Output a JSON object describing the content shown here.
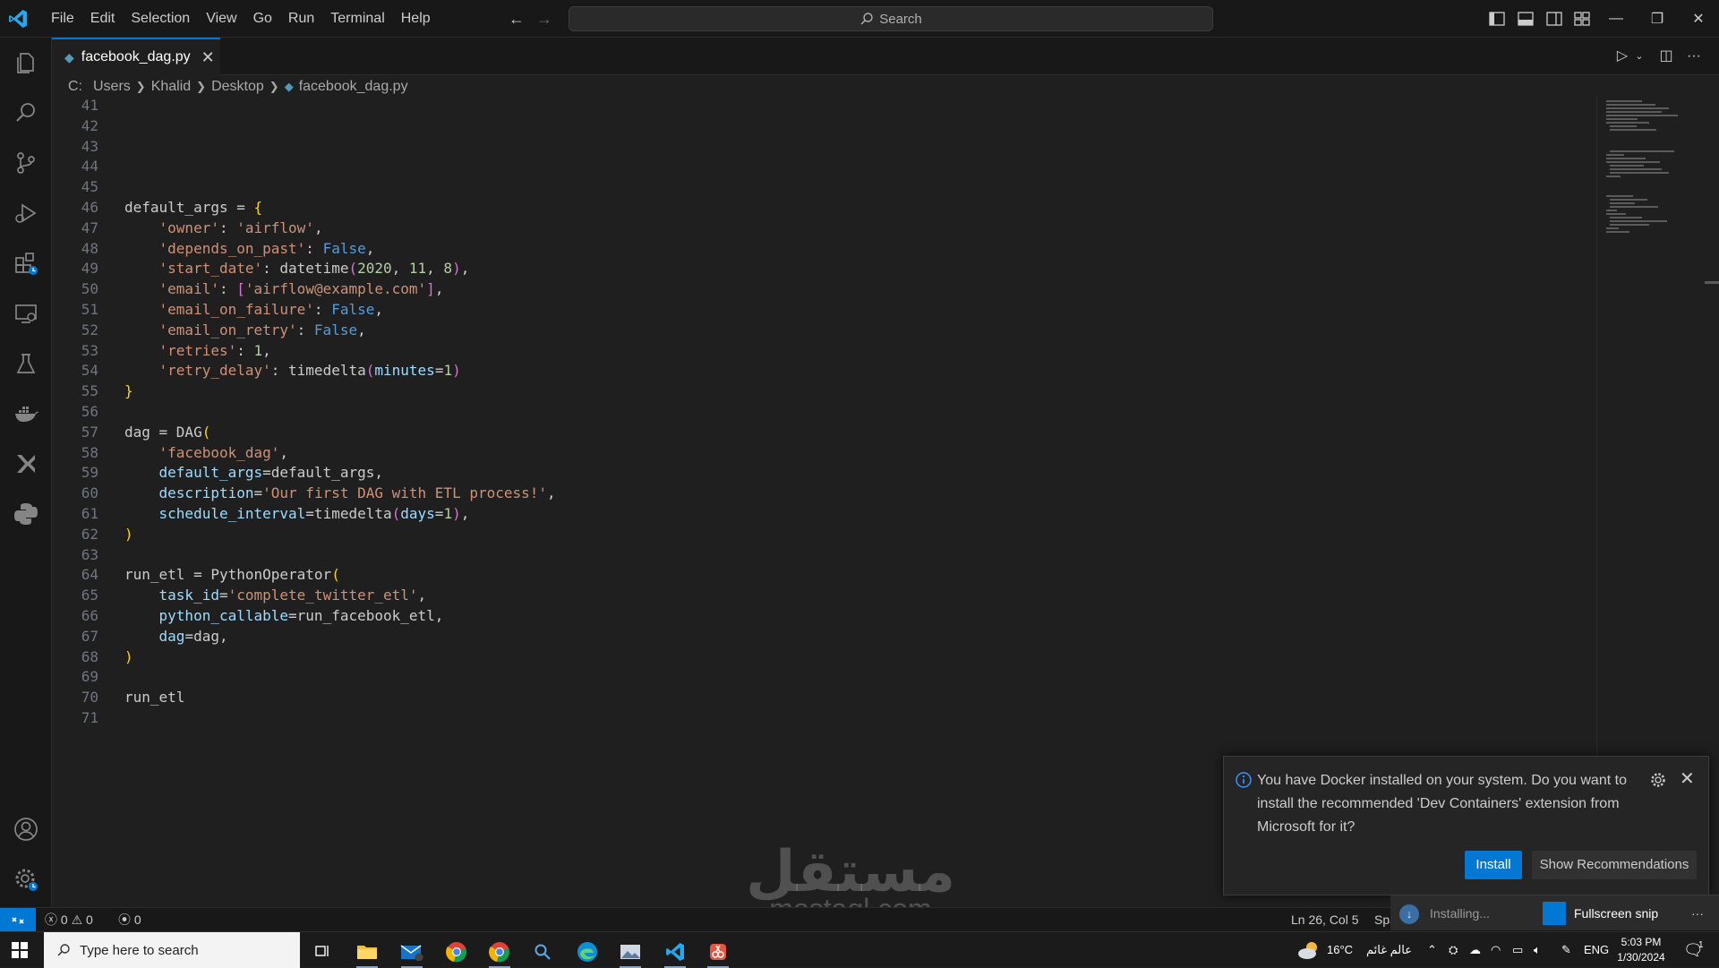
{
  "menu": [
    "File",
    "Edit",
    "Selection",
    "View",
    "Go",
    "Run",
    "Terminal",
    "Help"
  ],
  "search": {
    "label": "Search"
  },
  "tab": {
    "filename": "facebook_dag.py",
    "file_icon": "python-file-icon"
  },
  "breadcrumb": {
    "parts": [
      "C:",
      "Users",
      "Khalid",
      "Desktop"
    ],
    "file": "facebook_dag.py"
  },
  "code_lines": [
    {
      "n": "41",
      "html": ""
    },
    {
      "n": "42",
      "html": ""
    },
    {
      "n": "43",
      "html": ""
    },
    {
      "n": "44",
      "html": ""
    },
    {
      "n": "45",
      "html": ""
    },
    {
      "n": "46",
      "html": "default_args = <span class=\"b1\">{</span>"
    },
    {
      "n": "47",
      "html": "    <span class=\"s\">'owner'</span>: <span class=\"s\">'airflow'</span>,"
    },
    {
      "n": "48",
      "html": "    <span class=\"s\">'depends_on_past'</span>: <span class=\"k\">False</span>,"
    },
    {
      "n": "49",
      "html": "    <span class=\"s\">'start_date'</span>: datetime<span class=\"b2\">(</span><span class=\"n\">2020</span>, <span class=\"n\">11</span>, <span class=\"n\">8</span><span class=\"b2\">)</span>,"
    },
    {
      "n": "50",
      "html": "    <span class=\"s\">'email'</span>: <span class=\"b2\">[</span><span class=\"s\">'airflow@example.com'</span><span class=\"b2\">]</span>,"
    },
    {
      "n": "51",
      "html": "    <span class=\"s\">'email_on_failure'</span>: <span class=\"k\">False</span>,"
    },
    {
      "n": "52",
      "html": "    <span class=\"s\">'email_on_retry'</span>: <span class=\"k\">False</span>,"
    },
    {
      "n": "53",
      "html": "    <span class=\"s\">'retries'</span>: <span class=\"n\">1</span>,"
    },
    {
      "n": "54",
      "html": "    <span class=\"s\">'retry_delay'</span>: timedelta<span class=\"b2\">(</span><span class=\"p\">minutes</span>=<span class=\"n\">1</span><span class=\"b2\">)</span>"
    },
    {
      "n": "55",
      "html": "<span class=\"b1\">}</span>"
    },
    {
      "n": "56",
      "html": ""
    },
    {
      "n": "57",
      "html": "dag = DAG<span class=\"b1\">(</span>"
    },
    {
      "n": "58",
      "html": "    <span class=\"s\">'facebook_dag'</span>,"
    },
    {
      "n": "59",
      "html": "    <span class=\"p\">default_args</span>=default_args,"
    },
    {
      "n": "60",
      "html": "    <span class=\"p\">description</span>=<span class=\"s\">'Our first DAG with ETL process!'</span>,"
    },
    {
      "n": "61",
      "html": "    <span class=\"p\">schedule_interval</span>=timedelta<span class=\"b2\">(</span><span class=\"p\">days</span>=<span class=\"n\">1</span><span class=\"b2\">)</span>,"
    },
    {
      "n": "62",
      "html": "<span class=\"b1\">)</span>"
    },
    {
      "n": "63",
      "html": ""
    },
    {
      "n": "64",
      "html": "run_etl = PythonOperator<span class=\"b1\">(</span>"
    },
    {
      "n": "65",
      "html": "    <span class=\"p\">task_id</span>=<span class=\"s\">'complete_twitter_etl'</span>,"
    },
    {
      "n": "66",
      "html": "    <span class=\"p\">python_callable</span>=run_facebook_etl,"
    },
    {
      "n": "67",
      "html": "    <span class=\"p\">dag</span>=dag,"
    },
    {
      "n": "68",
      "html": "<span class=\"b1\">)</span>"
    },
    {
      "n": "69",
      "html": ""
    },
    {
      "n": "70",
      "html": "run_etl"
    },
    {
      "n": "71",
      "html": ""
    }
  ],
  "notification": {
    "message": "You have Docker installed on your system. Do you want to install the recommended 'Dev Containers' extension from Microsoft for it?",
    "install_label": "Install",
    "recommend_label": "Show Recommendations"
  },
  "status": {
    "errors": "0",
    "warnings": "0",
    "ports": "0",
    "cursor": "Ln 26, Col 5",
    "spaces": "Spa"
  },
  "snip": {
    "installing": "Installing...",
    "fullscreen": "Fullscreen snip",
    "more": "···"
  },
  "watermark": {
    "arabic": "مستقل",
    "latin": "mostaql.com"
  },
  "taskbar": {
    "search_placeholder": "Type here to search",
    "weather": "16°C",
    "weather_text": "عالم غائم",
    "lang": "ENG",
    "time": "5:03 PM",
    "date": "1/30/2024",
    "notif_count": "1"
  },
  "colors": {
    "accent": "#0078d4",
    "editor_bg": "#1f1f1f",
    "chrome_bg": "#181818"
  }
}
